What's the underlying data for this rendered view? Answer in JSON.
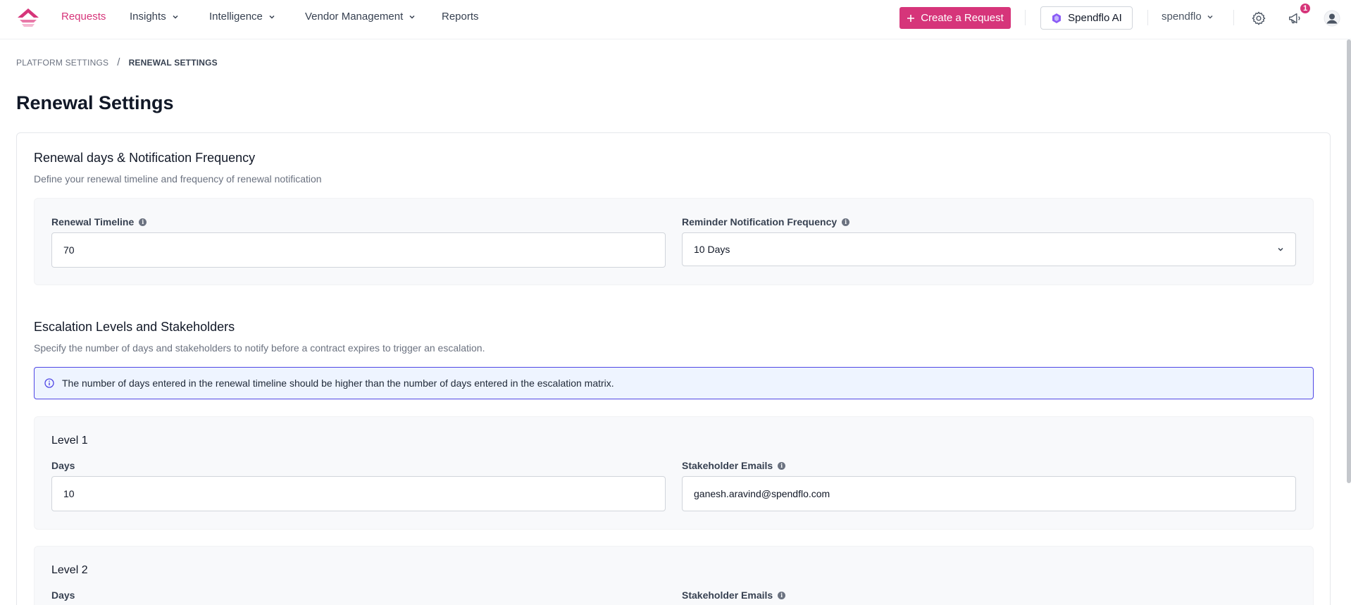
{
  "nav": {
    "items": [
      {
        "label": "Requests",
        "has_dropdown": false,
        "active": true
      },
      {
        "label": "Insights",
        "has_dropdown": true,
        "active": false
      },
      {
        "label": "Intelligence",
        "has_dropdown": true,
        "active": false
      },
      {
        "label": "Vendor Management",
        "has_dropdown": true,
        "active": false
      },
      {
        "label": "Reports",
        "has_dropdown": false,
        "active": false
      }
    ],
    "create_label": "Create a Request",
    "ai_label": "Spendflo AI",
    "org_label": "spendflo",
    "notification_count": "1",
    "icons": [
      "logo-icon",
      "plus-icon",
      "spendflo-ai-icon",
      "chevron-down-icon",
      "gear-icon",
      "megaphone-icon",
      "user-avatar-icon"
    ],
    "accent_color": "#d6357a"
  },
  "breadcrumb": {
    "parent": "PLATFORM SETTINGS",
    "separator": "/",
    "current": "RENEWAL SETTINGS"
  },
  "page": {
    "title": "Renewal Settings"
  },
  "renewal": {
    "title": "Renewal days & Notification Frequency",
    "description": "Define your renewal timeline and frequency of renewal notification",
    "timeline_label": "Renewal Timeline",
    "timeline_value": "70",
    "frequency_label": "Reminder Notification Frequency",
    "frequency_value": "10 Days"
  },
  "escalation": {
    "title": "Escalation Levels and Stakeholders",
    "description": "Specify the number of days and stakeholders to notify before a contract expires to trigger an escalation.",
    "alert": "The number of days entered in the renewal timeline should be higher than the number of days entered in the escalation matrix.",
    "alert_border_color": "#4f46e5",
    "levels": [
      {
        "title": "Level 1",
        "days_label": "Days",
        "days_value": "10",
        "emails_label": "Stakeholder Emails",
        "emails_value": "ganesh.aravind@spendflo.com"
      },
      {
        "title": "Level 2",
        "days_label": "Days",
        "emails_label": "Stakeholder Emails"
      }
    ]
  }
}
